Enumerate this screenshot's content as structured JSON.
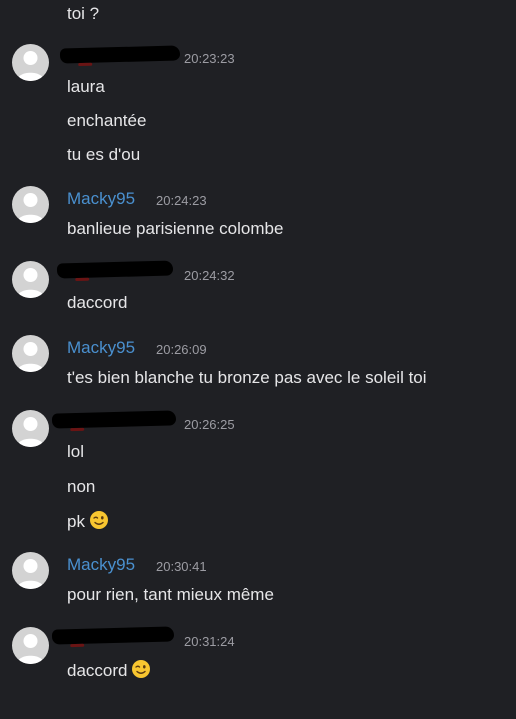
{
  "chat": {
    "top_partial": "toi ?",
    "groups": [
      {
        "author": "",
        "author_redacted": true,
        "time": "20:23:23",
        "messages": [
          "laura",
          "enchantée",
          "tu es d'ou"
        ]
      },
      {
        "author": "Macky95",
        "author_redacted": false,
        "time": "20:24:23",
        "messages": [
          "banlieue parisienne colombe"
        ]
      },
      {
        "author": "",
        "author_redacted": true,
        "time": "20:24:32",
        "messages": [
          "daccord"
        ]
      },
      {
        "author": "Macky95",
        "author_redacted": false,
        "time": "20:26:09",
        "messages": [
          "t'es bien blanche tu bronze pas avec le soleil toi"
        ]
      },
      {
        "author": "",
        "author_redacted": true,
        "time": "20:26:25",
        "messages": [
          "lol",
          "non",
          "pk"
        ]
      },
      {
        "author": "Macky95",
        "author_redacted": false,
        "time": "20:30:41",
        "messages": [
          "pour rien, tant mieux même"
        ]
      },
      {
        "author": "",
        "author_redacted": true,
        "time": "20:31:24",
        "messages": [
          "daccord"
        ]
      }
    ],
    "emoji_icon": "winking-face-icon",
    "avatar_icon": "default-user-avatar-icon",
    "colors": {
      "background": "#1f2024",
      "author": "#4a90cf",
      "timestamp": "#9c9ca3",
      "text": "#e6e6e8",
      "avatar": "#d3d3d3"
    }
  }
}
